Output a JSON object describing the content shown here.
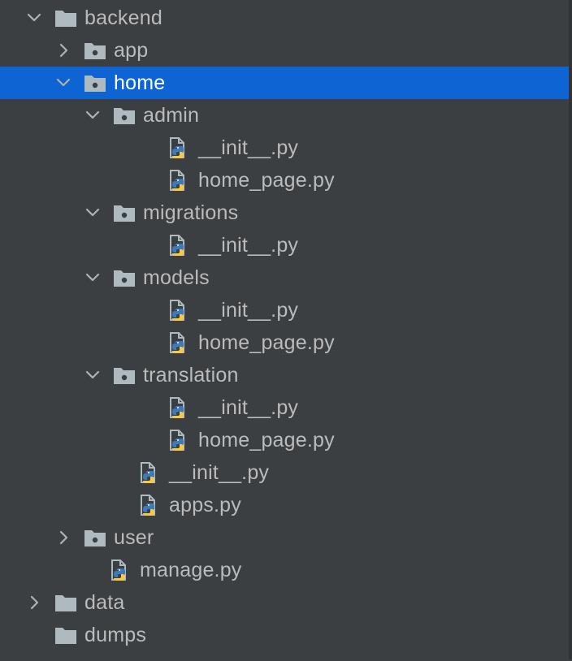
{
  "colors": {
    "background": "#3c3f41",
    "selection": "#0d64d2",
    "text": "#bbbbbb",
    "folder_icon": "#aeb9c0",
    "python_blue": "#3d7ab8",
    "python_yellow": "#f7c948"
  },
  "tree": {
    "items": [
      {
        "label": "backend",
        "type": "folder",
        "icon": "folder-icon",
        "level": 0,
        "expand": "expanded"
      },
      {
        "label": "app",
        "type": "package",
        "icon": "package-folder-icon",
        "level": 1,
        "expand": "collapsed"
      },
      {
        "label": "home",
        "type": "package",
        "icon": "package-folder-icon",
        "level": 1,
        "expand": "expanded",
        "selected": true
      },
      {
        "label": "admin",
        "type": "package",
        "icon": "package-folder-icon",
        "level": 2,
        "expand": "expanded"
      },
      {
        "label": "__init__.py",
        "type": "python",
        "icon": "python-file-icon",
        "level": 3
      },
      {
        "label": "home_page.py",
        "type": "python",
        "icon": "python-file-icon",
        "level": 3
      },
      {
        "label": "migrations",
        "type": "package",
        "icon": "package-folder-icon",
        "level": 2,
        "expand": "expanded"
      },
      {
        "label": "__init__.py",
        "type": "python",
        "icon": "python-file-icon",
        "level": 3
      },
      {
        "label": "models",
        "type": "package",
        "icon": "package-folder-icon",
        "level": 2,
        "expand": "expanded"
      },
      {
        "label": "__init__.py",
        "type": "python",
        "icon": "python-file-icon",
        "level": 3
      },
      {
        "label": "home_page.py",
        "type": "python",
        "icon": "python-file-icon",
        "level": 3
      },
      {
        "label": "translation",
        "type": "package",
        "icon": "package-folder-icon",
        "level": 2,
        "expand": "expanded"
      },
      {
        "label": "__init__.py",
        "type": "python",
        "icon": "python-file-icon",
        "level": 3
      },
      {
        "label": "home_page.py",
        "type": "python",
        "icon": "python-file-icon",
        "level": 3
      },
      {
        "label": "__init__.py",
        "type": "python",
        "icon": "python-file-icon",
        "level": 2
      },
      {
        "label": "apps.py",
        "type": "python",
        "icon": "python-file-icon",
        "level": 2
      },
      {
        "label": "user",
        "type": "package",
        "icon": "package-folder-icon",
        "level": 1,
        "expand": "collapsed"
      },
      {
        "label": "manage.py",
        "type": "python",
        "icon": "python-file-icon",
        "level": 1
      },
      {
        "label": "data",
        "type": "folder",
        "icon": "folder-icon",
        "level": 0,
        "expand": "collapsed"
      },
      {
        "label": "dumps",
        "type": "folder",
        "icon": "folder-icon",
        "level": 0,
        "expand": "none"
      }
    ]
  }
}
